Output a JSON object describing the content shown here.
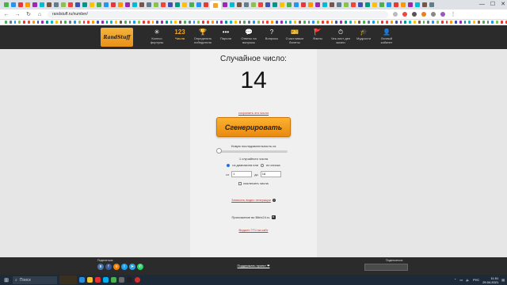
{
  "browser": {
    "url": "randstuff.ru/number/",
    "nav_icons": [
      "back-icon",
      "forward-icon",
      "reload-icon",
      "home-icon"
    ]
  },
  "site": {
    "logo": "RandStuff",
    "nav": [
      {
        "icon": "wheel-icon",
        "glyph": "✳",
        "label": "Колесо фортуны",
        "active": false
      },
      {
        "icon": "number-icon",
        "glyph": "123",
        "label": "Числа",
        "active": true
      },
      {
        "icon": "trophy-icon",
        "glyph": "🏆",
        "label": "Определить победителя",
        "active": false
      },
      {
        "icon": "password-icon",
        "glyph": "•••",
        "label": "Пароли",
        "active": false
      },
      {
        "icon": "answers-icon",
        "glyph": "💬",
        "label": "Ответы на вопросы",
        "active": false
      },
      {
        "icon": "question-icon",
        "glyph": "?",
        "label": "Вопросы",
        "active": false
      },
      {
        "icon": "ticket-icon",
        "glyph": "🎫",
        "label": "Счастливые билеты",
        "active": false
      },
      {
        "icon": "facts-icon",
        "glyph": "🚩",
        "label": "Факты",
        "active": false
      },
      {
        "icon": "checklist-icon",
        "glyph": "⏱",
        "label": "Чек-лист дел жизни",
        "active": false
      },
      {
        "icon": "wisdom-icon",
        "glyph": "🎓",
        "label": "Мудрости",
        "active": false
      },
      {
        "icon": "user-icon",
        "glyph": "👤",
        "label": "Личный кабинет",
        "active": false
      }
    ]
  },
  "main": {
    "title": "Случайное число:",
    "number": "14",
    "save_link": "сохранить это число",
    "generate_button": "Сгенерировать",
    "sequence_caption": "Новую последовательность из",
    "sequence_value": 0,
    "count_caption": "1 случайного числа",
    "radio_range": "из диапазона или",
    "radio_list": "из списка",
    "from_label": "от",
    "from_value": "1",
    "to_label": "до",
    "to_value": "16",
    "exclude_label": "исключить числа",
    "video_link": "Записать видео генерации",
    "app_text": "Приложение во Bitrix24.ru",
    "widget_link": "Виджет ГГЧ на сайт"
  },
  "footer": {
    "share_label": "Поделиться:",
    "share_icons": [
      {
        "icon": "vk-icon",
        "glyph": "в",
        "color": "#4a76a8"
      },
      {
        "icon": "facebook-icon",
        "glyph": "f",
        "color": "#3b5998"
      },
      {
        "icon": "odnoklassniki-icon",
        "glyph": "о",
        "color": "#ee8208"
      },
      {
        "icon": "twitter-icon",
        "glyph": "t",
        "color": "#1da1f2"
      },
      {
        "icon": "telegram-icon",
        "glyph": "➤",
        "color": "#2ca5e0"
      },
      {
        "icon": "whatsapp-icon",
        "glyph": "✆",
        "color": "#25d366"
      }
    ],
    "support_link": "Поддержать проект ❤",
    "subscribe_label": "Подписаться:"
  },
  "taskbar": {
    "search_label": "Поиск",
    "language": "РУС",
    "time": "11:51",
    "date": "29.04.2021"
  }
}
